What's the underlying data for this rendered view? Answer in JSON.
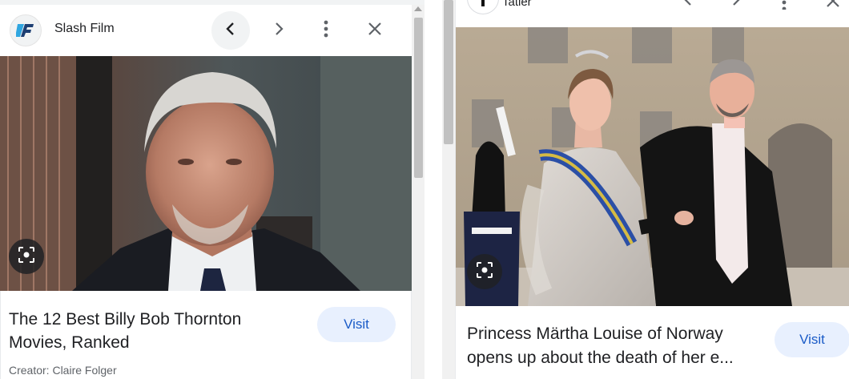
{
  "left_card": {
    "site_name": "Slash Film",
    "title": "The 12 Best Billy Bob Thornton Movies, Ranked",
    "visit_label": "Visit",
    "creator": "Creator: Claire Folger",
    "icons": [
      "slashfilm-logo",
      "chevron-left-icon",
      "chevron-right-icon",
      "more-vert-icon",
      "close-icon",
      "lens-icon"
    ]
  },
  "right_card": {
    "site_name": "Tatler",
    "title": "Princess Märtha Louise of Norway opens up about the death of her e...",
    "visit_label": "Visit",
    "icons": [
      "tatler-logo",
      "chevron-left-icon",
      "chevron-right-icon",
      "more-vert-icon",
      "close-icon",
      "lens-icon"
    ]
  },
  "colors": {
    "visit_bg": "#e8f0fe",
    "visit_text": "#1a5bc7",
    "icon_gray": "#5f6368",
    "text": "#202124"
  }
}
